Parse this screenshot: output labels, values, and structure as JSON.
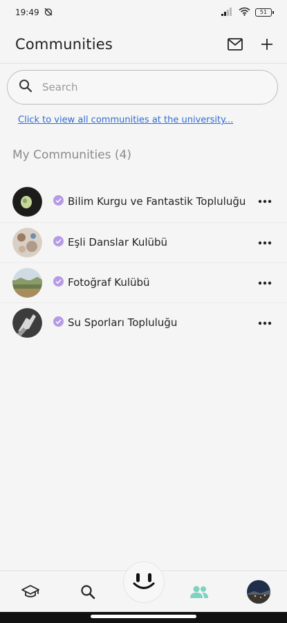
{
  "status_bar": {
    "time": "19:49",
    "battery": "51"
  },
  "header": {
    "title": "Communities",
    "mail_icon": "envelope-icon",
    "add_icon": "plus-icon"
  },
  "search": {
    "placeholder": "Search",
    "value": ""
  },
  "all_communities_link": "Click to view all communities at the university...",
  "my_communities": {
    "title": "My Communities (4)",
    "items": [
      {
        "name": "Bilim Kurgu ve Fantastik Topluluğu",
        "verified": true
      },
      {
        "name": "Eşli Danslar Kulübü",
        "verified": true
      },
      {
        "name": "Fotoğraf Kulübü",
        "verified": true
      },
      {
        "name": "Su Sporları Topluluğu",
        "verified": true
      }
    ]
  },
  "colors": {
    "accent": "#b59ae6",
    "link": "#2e6bd6",
    "active_nav": "#7dd3c0"
  },
  "bottom_nav": {
    "items": [
      {
        "icon": "graduation-cap-icon"
      },
      {
        "icon": "search-icon"
      },
      {
        "icon": "mascot-face-icon"
      },
      {
        "icon": "people-icon",
        "active": true
      },
      {
        "icon": "profile-avatar"
      }
    ]
  }
}
